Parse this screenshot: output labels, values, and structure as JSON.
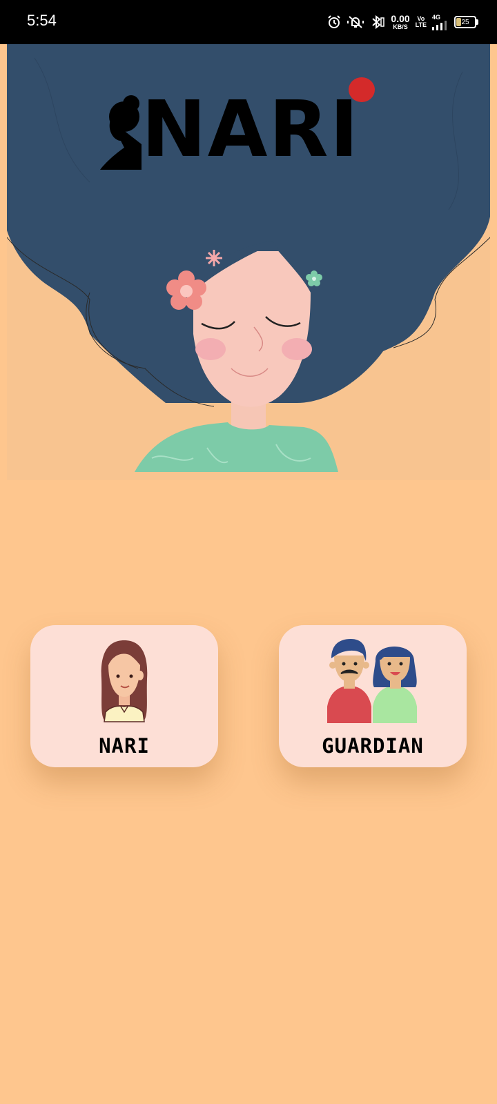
{
  "status_bar": {
    "time": "5:54",
    "net_speed_value": "0.00",
    "net_speed_unit": "KB/S",
    "volte_top": "Vo",
    "volte_bottom": "LTE",
    "network": "4G",
    "battery": "25",
    "icons": [
      "alarm-icon",
      "silent-icon",
      "bluetooth-icon",
      "signal-icon",
      "battery-icon"
    ]
  },
  "hero": {
    "logo_text": "NARI"
  },
  "roles": [
    {
      "label": "NARI",
      "icon": "woman-avatar-icon"
    },
    {
      "label": "GUARDIAN",
      "icon": "parents-avatar-icon"
    }
  ],
  "colors": {
    "background": "#FEC68E",
    "hair": "#334E6B",
    "card": "#FDDFD6",
    "logo_dot": "#D42A2A"
  }
}
